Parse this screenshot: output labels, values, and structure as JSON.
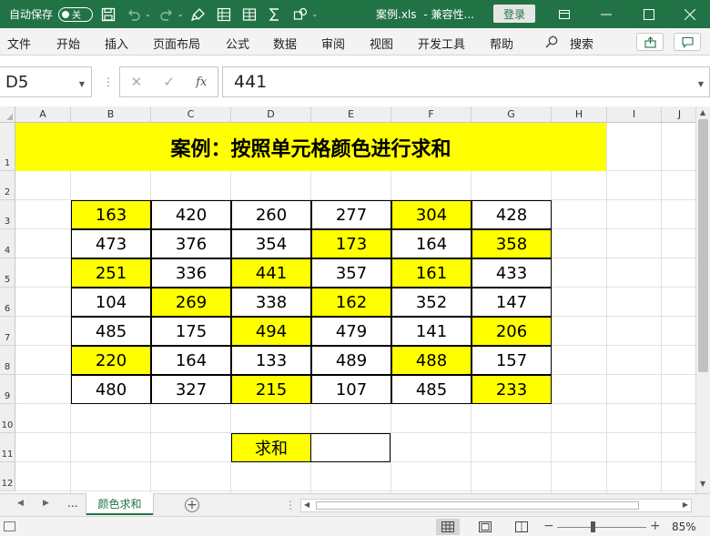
{
  "titlebar": {
    "autosave_label": "自动保存",
    "autosave_state": "关",
    "filename": "案例.xls",
    "compat": "兼容性...",
    "login_label": "登录"
  },
  "menu": {
    "items": [
      "文件",
      "开始",
      "插入",
      "页面布局",
      "公式",
      "数据",
      "审阅",
      "视图",
      "开发工具",
      "帮助"
    ],
    "search_label": "搜索"
  },
  "formula_bar": {
    "name_box": "D5",
    "formula": "441"
  },
  "grid": {
    "columns": [
      "A",
      "B",
      "C",
      "D",
      "E",
      "F",
      "G",
      "H",
      "I",
      "J"
    ],
    "rows": [
      "1",
      "2",
      "3",
      "4",
      "5",
      "6",
      "7",
      "8",
      "9",
      "10",
      "11",
      "12"
    ],
    "title": "案例：按照单元格颜色进行求和",
    "table": [
      [
        {
          "v": "163",
          "hl": true
        },
        {
          "v": "420",
          "hl": false
        },
        {
          "v": "260",
          "hl": false
        },
        {
          "v": "277",
          "hl": false
        },
        {
          "v": "304",
          "hl": true
        },
        {
          "v": "428",
          "hl": false
        }
      ],
      [
        {
          "v": "473",
          "hl": false
        },
        {
          "v": "376",
          "hl": false
        },
        {
          "v": "354",
          "hl": false
        },
        {
          "v": "173",
          "hl": true
        },
        {
          "v": "164",
          "hl": false
        },
        {
          "v": "358",
          "hl": true
        }
      ],
      [
        {
          "v": "251",
          "hl": true
        },
        {
          "v": "336",
          "hl": false
        },
        {
          "v": "441",
          "hl": true
        },
        {
          "v": "357",
          "hl": false
        },
        {
          "v": "161",
          "hl": true
        },
        {
          "v": "433",
          "hl": false
        }
      ],
      [
        {
          "v": "104",
          "hl": false
        },
        {
          "v": "269",
          "hl": true
        },
        {
          "v": "338",
          "hl": false
        },
        {
          "v": "162",
          "hl": true
        },
        {
          "v": "352",
          "hl": false
        },
        {
          "v": "147",
          "hl": false
        }
      ],
      [
        {
          "v": "485",
          "hl": false
        },
        {
          "v": "175",
          "hl": false
        },
        {
          "v": "494",
          "hl": true
        },
        {
          "v": "479",
          "hl": false
        },
        {
          "v": "141",
          "hl": false
        },
        {
          "v": "206",
          "hl": true
        }
      ],
      [
        {
          "v": "220",
          "hl": true
        },
        {
          "v": "164",
          "hl": false
        },
        {
          "v": "133",
          "hl": false
        },
        {
          "v": "489",
          "hl": false
        },
        {
          "v": "488",
          "hl": true
        },
        {
          "v": "157",
          "hl": false
        }
      ],
      [
        {
          "v": "480",
          "hl": false
        },
        {
          "v": "327",
          "hl": false
        },
        {
          "v": "215",
          "hl": true
        },
        {
          "v": "107",
          "hl": false
        },
        {
          "v": "485",
          "hl": false
        },
        {
          "v": "233",
          "hl": true
        }
      ]
    ],
    "sum_label": "求和",
    "sum_value": "",
    "highlight_color": "#ffff00"
  },
  "sheets": {
    "more": "...",
    "active_tab": "颜色求和",
    "add": "+"
  },
  "status": {
    "zoom": "85%",
    "zoom_level": 0.4,
    "minus": "−",
    "plus": "+"
  },
  "colors": {
    "accent": "#217346"
  }
}
